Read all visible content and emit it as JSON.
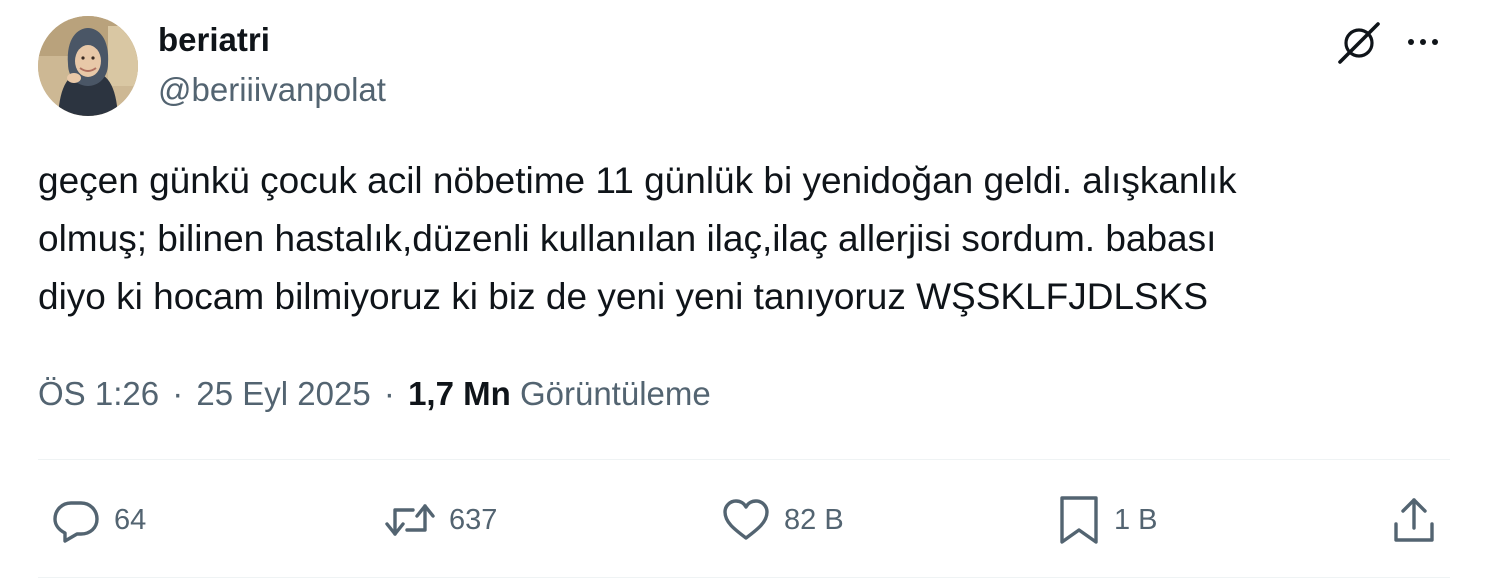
{
  "author": {
    "display_name": "beriatri",
    "handle": "@beriiivanpolat",
    "avatar_icon": "profile-photo"
  },
  "header_icons": {
    "grok": "grok-icon",
    "more": "more-icon"
  },
  "tweet": {
    "lines": [
      "geçen günkü çocuk acil nöbetime 11 günlük bi yenidoğan geldi. alışkanlık",
      "olmuş; bilinen hastalık,düzenli kullanılan ilaç,ilaç allerjisi sordum. babası",
      "diyo ki hocam bilmiyoruz ki biz de yeni yeni tanıyoruz WŞSKLFJDLSKS"
    ]
  },
  "meta": {
    "time": "ÖS 1:26",
    "separator": "·",
    "date": "25 Eyl 2025",
    "views_count": "1,7 Mn",
    "views_label": "Görüntüleme"
  },
  "actions": {
    "reply_count": "64",
    "retweet_count": "637",
    "like_count": "82 B",
    "bookmark_count": "1 B"
  },
  "colors": {
    "text_primary": "#0f1419",
    "text_secondary": "#536471",
    "divider": "#eff3f4"
  }
}
